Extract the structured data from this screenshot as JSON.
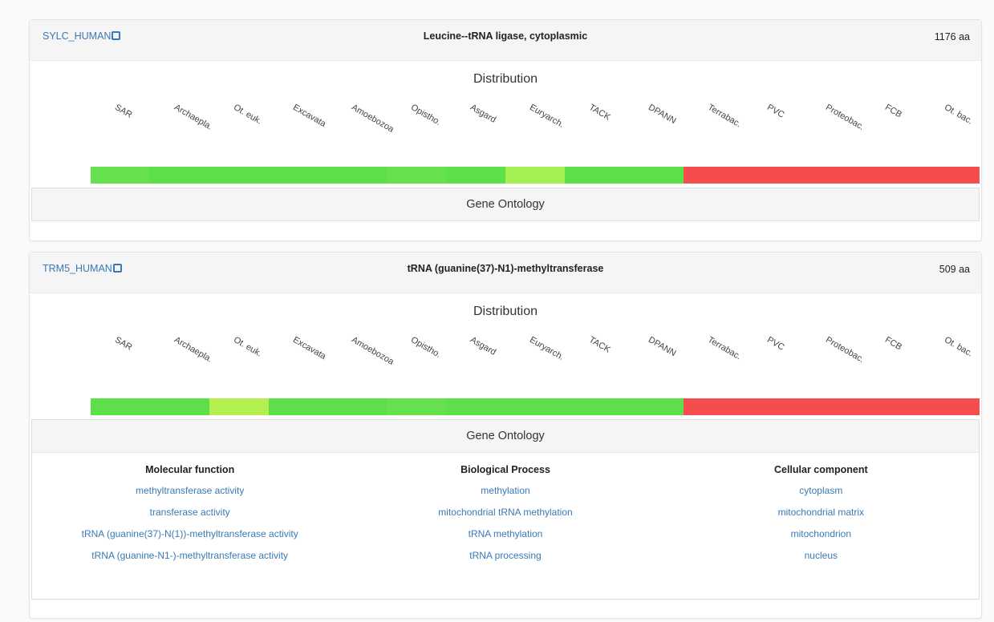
{
  "cards": [
    {
      "id": "SYLC_HUMAN",
      "name": "Leucine--tRNA ligase, cytoplasmic",
      "length": "1176 aa",
      "distribution_title": "Distribution",
      "go_title": "Gene Ontology",
      "segments": [
        {
          "label": "SAR",
          "color": "#66e04d"
        },
        {
          "label": "Archaepla.",
          "color": "#5cdf48"
        },
        {
          "label": "Ot. euk.",
          "color": "#5cdf48"
        },
        {
          "label": "Excavata",
          "color": "#5cdf48"
        },
        {
          "label": "Amoebozoa",
          "color": "#5cdf48"
        },
        {
          "label": "Opistho.",
          "color": "#66e04d"
        },
        {
          "label": "Asgard",
          "color": "#5cdf48"
        },
        {
          "label": "Euryarch.",
          "color": "#a4ef52"
        },
        {
          "label": "TACK",
          "color": "#5cdf48"
        },
        {
          "label": "DPANN",
          "color": "#5cdf48"
        },
        {
          "label": "Terrabac.",
          "color": "#f54d4d"
        },
        {
          "label": "PVC",
          "color": "#f54d4d"
        },
        {
          "label": "Proteobac.",
          "color": "#f54d4d"
        },
        {
          "label": "FCB",
          "color": "#f54d4d"
        },
        {
          "label": "Ot. bac.",
          "color": "#f54d4d"
        }
      ]
    },
    {
      "id": "TRM5_HUMAN",
      "name": "tRNA (guanine(37)-N1)-methyltransferase",
      "length": "509 aa",
      "distribution_title": "Distribution",
      "go_title": "Gene Ontology",
      "segments": [
        {
          "label": "SAR",
          "color": "#5cdf48"
        },
        {
          "label": "Archaepla.",
          "color": "#5cdf48"
        },
        {
          "label": "Ot. euk.",
          "color": "#b3f04f"
        },
        {
          "label": "Excavata",
          "color": "#5cdf48"
        },
        {
          "label": "Amoebozoa",
          "color": "#5cdf48"
        },
        {
          "label": "Opistho.",
          "color": "#66e04d"
        },
        {
          "label": "Asgard",
          "color": "#5cdf48"
        },
        {
          "label": "Euryarch.",
          "color": "#5cdf48"
        },
        {
          "label": "TACK",
          "color": "#5cdf48"
        },
        {
          "label": "DPANN",
          "color": "#5cdf48"
        },
        {
          "label": "Terrabac.",
          "color": "#f54d4d"
        },
        {
          "label": "PVC",
          "color": "#f54d4d"
        },
        {
          "label": "Proteobac.",
          "color": "#f54d4d"
        },
        {
          "label": "FCB",
          "color": "#f54d4d"
        },
        {
          "label": "Ot. bac.",
          "color": "#f54d4d"
        }
      ],
      "go": [
        {
          "heading": "Molecular function",
          "items": [
            "methyltransferase activity",
            "transferase activity",
            "tRNA (guanine(37)-N(1))-methyltransferase activity",
            "tRNA (guanine-N1-)-methyltransferase activity"
          ]
        },
        {
          "heading": "Biological Process",
          "items": [
            "methylation",
            "mitochondrial tRNA methylation",
            "tRNA methylation",
            "tRNA processing"
          ]
        },
        {
          "heading": "Cellular component",
          "items": [
            "cytoplasm",
            "mitochondrial matrix",
            "mitochondrion",
            "nucleus"
          ]
        }
      ]
    }
  ]
}
